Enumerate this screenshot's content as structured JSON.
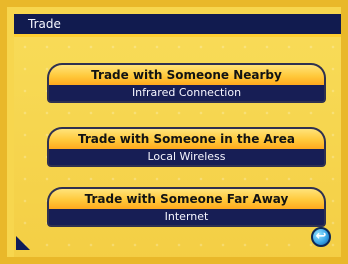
{
  "screen": {
    "title": "Trade"
  },
  "options": [
    {
      "title": "Trade with Someone Nearby",
      "subtitle": "Infrared Connection"
    },
    {
      "title": "Trade with Someone in the Area",
      "subtitle": "Local Wireless"
    },
    {
      "title": "Trade with Someone Far Away",
      "subtitle": "Internet"
    }
  ],
  "controls": {
    "back_icon": "back-arrow-icon"
  }
}
